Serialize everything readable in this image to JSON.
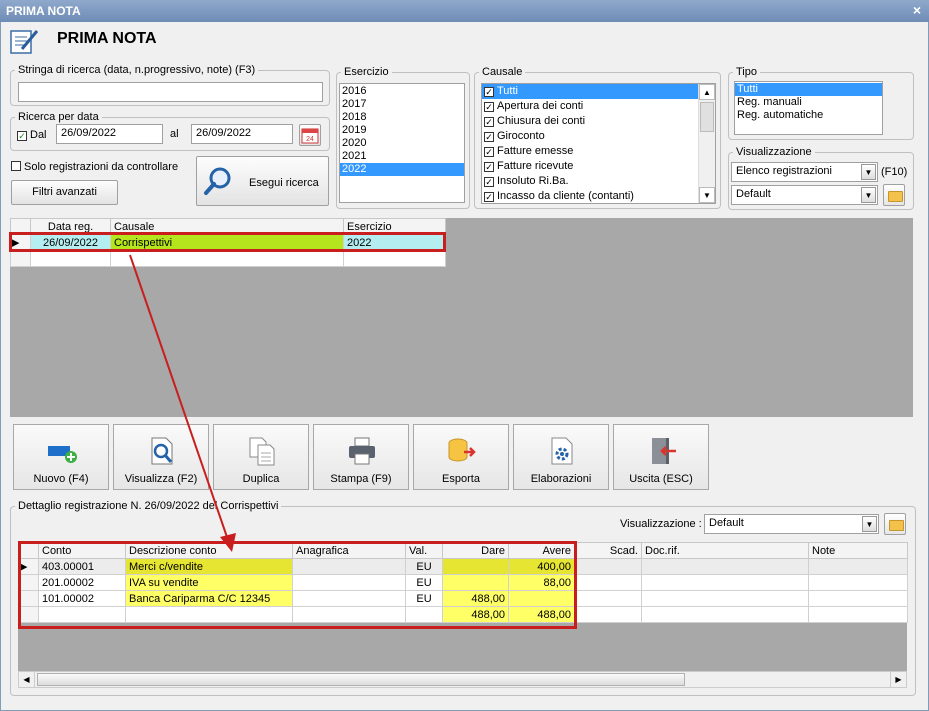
{
  "window": {
    "title": "PRIMA NOTA",
    "close_glyph": "×"
  },
  "header": {
    "title": "PRIMA NOTA",
    "icon": "notepad-pen-icon"
  },
  "search": {
    "legend": "Stringa di ricerca (data, n.progressivo, note) (F3)",
    "value": ""
  },
  "date_search": {
    "legend": "Ricerca per data",
    "dal_label": "Dal",
    "dal_checked": true,
    "from": "26/09/2022",
    "al_label": "al",
    "to": "26/09/2022",
    "calendar_day": "24"
  },
  "solo_da_controllare": {
    "label": "Solo registrazioni da controllare",
    "checked": false
  },
  "filtri_label": "Filtri avanzati",
  "search_button_label": "Esegui ricerca",
  "esercizio": {
    "legend": "Esercizio",
    "items": [
      "2016",
      "2017",
      "2018",
      "2019",
      "2020",
      "2021",
      "2022"
    ],
    "selected": "2022"
  },
  "causale": {
    "legend": "Causale",
    "items": [
      "Tutti",
      "Apertura dei conti",
      "Chiusura dei conti",
      "Giroconto",
      "Fatture emesse",
      "Fatture ricevute",
      "Insoluto Ri.Ba.",
      "Incasso da cliente (contanti)"
    ]
  },
  "tipo": {
    "legend": "Tipo",
    "items": [
      "Tutti",
      "Reg. manuali",
      "Reg. automatiche"
    ]
  },
  "visualizzazione_top": {
    "legend": "Visualizzazione",
    "combo1": "Elenco registrazioni",
    "shortcut": "(F10)",
    "combo2": "Default"
  },
  "registrations": {
    "headers": [
      "Data reg.",
      "Causale",
      "Esercizio"
    ],
    "rows": [
      {
        "date": "26/09/2022",
        "causale": "Corrispettivi",
        "esercizio": "2022"
      }
    ]
  },
  "toolbar": {
    "nuovo": "Nuovo (F4)",
    "visualizza": "Visualizza (F2)",
    "duplica": "Duplica",
    "stampa": "Stampa (F9)",
    "esporta": "Esporta",
    "elaborazioni": "Elaborazioni",
    "uscita": "Uscita (ESC)"
  },
  "detail": {
    "legend": "Dettaglio registrazione N. 26/09/2022 del Corrispettivi",
    "view_label": "Visualizzazione :",
    "view_value": "Default",
    "headers": [
      "Conto",
      "Descrizione conto",
      "Anagrafica",
      "Val.",
      "Dare",
      "Avere",
      "Scad.",
      "Doc.rif.",
      "Note"
    ],
    "rows": [
      {
        "conto": "403.00001",
        "descrizione": "Merci c/vendite",
        "anagrafica": "",
        "val": "EU",
        "dare": "",
        "avere": "400,00"
      },
      {
        "conto": "201.00002",
        "descrizione": "IVA su vendite",
        "anagrafica": "",
        "val": "EU",
        "dare": "",
        "avere": "88,00"
      },
      {
        "conto": "101.00002",
        "descrizione": "Banca Cariparma C/C 12345",
        "anagrafica": "",
        "val": "EU",
        "dare": "488,00",
        "avere": ""
      }
    ],
    "totals": {
      "dare": "488,00",
      "avere": "488,00"
    }
  },
  "colors": {
    "highlight_green": "#b5e61d",
    "highlight_cyan": "#b4eef0",
    "highlight_yellow": "#ffff66",
    "annotation_red": "#c81e1e",
    "selection_blue": "#3399ff"
  }
}
